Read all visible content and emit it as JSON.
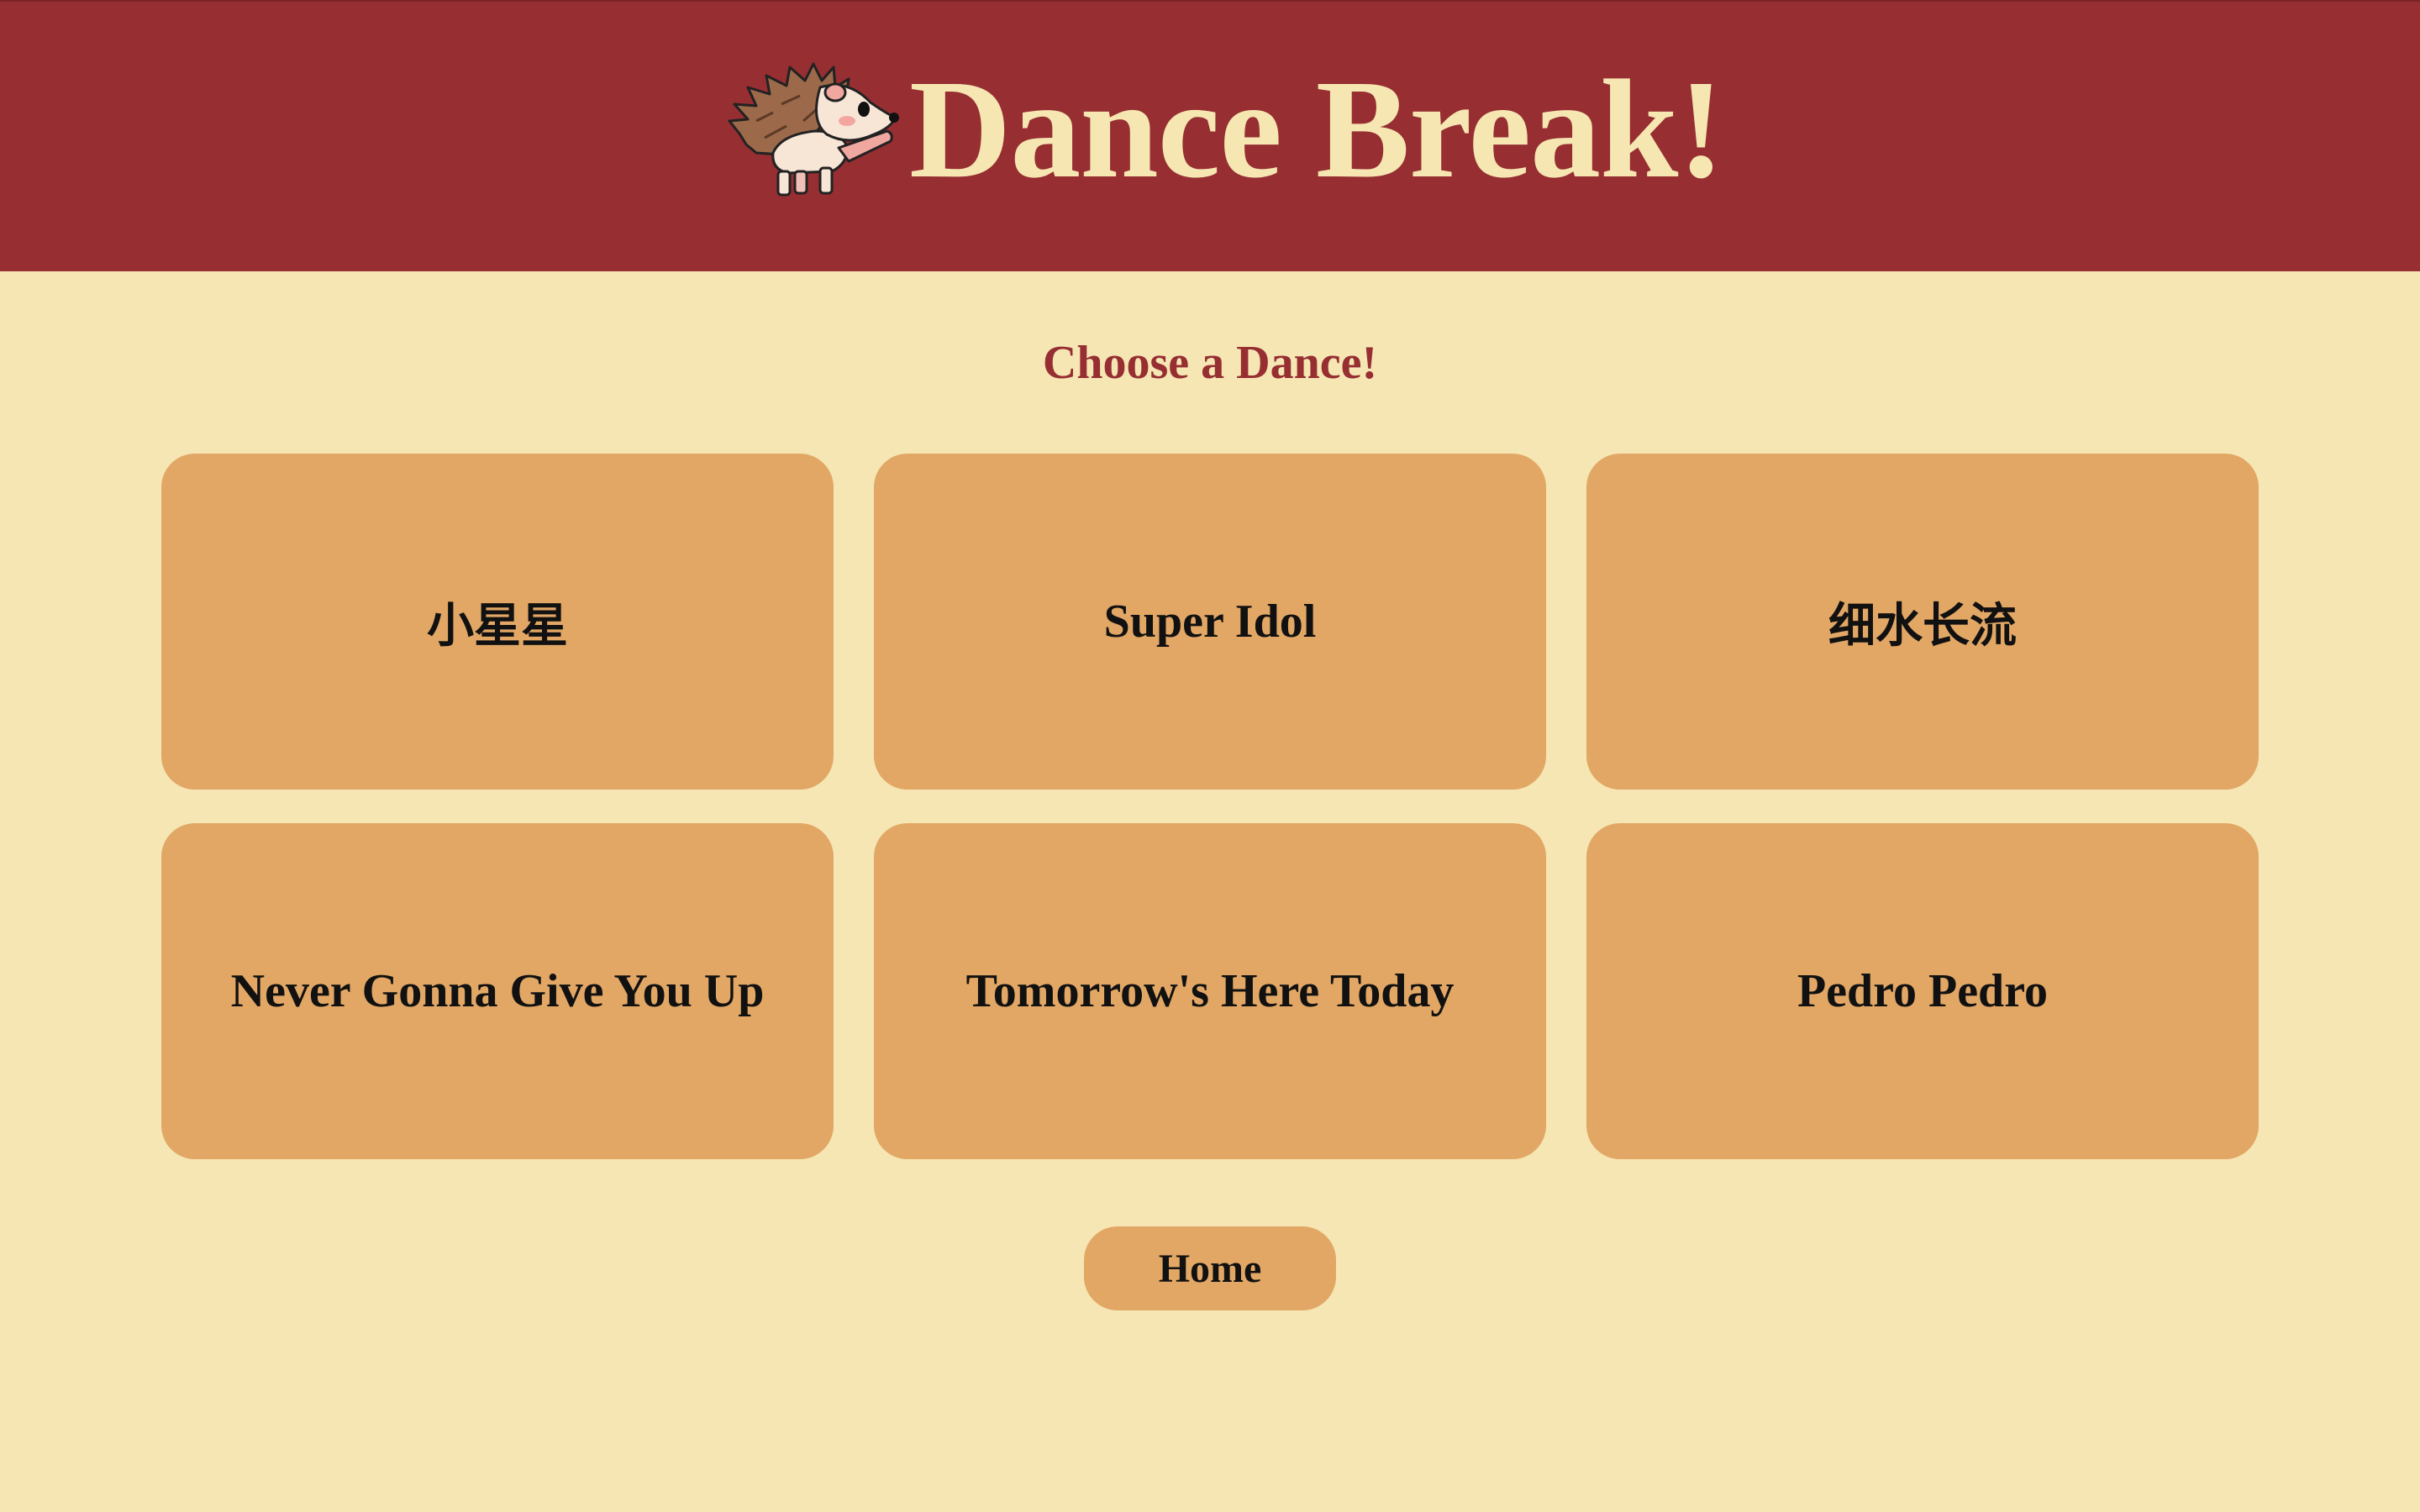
{
  "header": {
    "title": "Dance Break!",
    "mascot_icon": "hedgehog-dancing-icon",
    "background_color": "#962e32",
    "title_color": "#f6e6b2"
  },
  "main": {
    "subtitle": "Choose a Dance!",
    "subtitle_color": "#962e32",
    "background_color": "#f5e6b4",
    "card_color": "#e2a765",
    "dances": [
      {
        "label": "小星星"
      },
      {
        "label": "Super Idol"
      },
      {
        "label": "细水长流"
      },
      {
        "label": "Never Gonna Give You Up"
      },
      {
        "label": "Tomorrow's Here Today"
      },
      {
        "label": "Pedro Pedro"
      }
    ]
  },
  "footer": {
    "home_label": "Home"
  }
}
